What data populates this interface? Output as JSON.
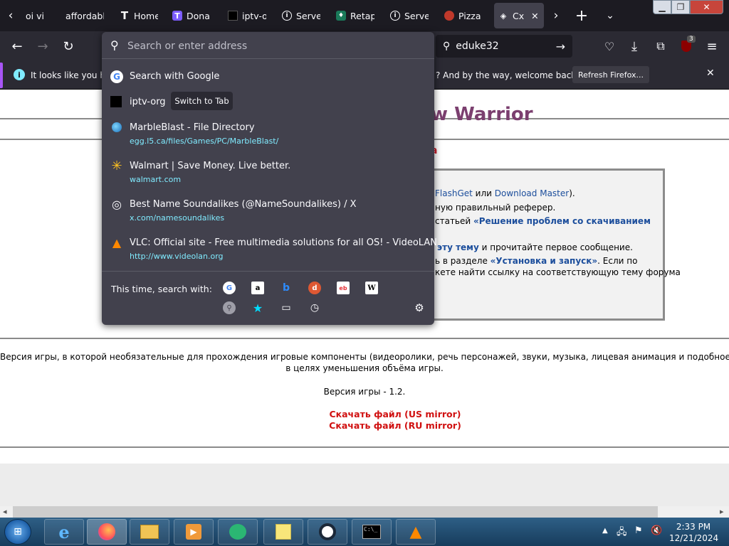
{
  "tabs": [
    {
      "label": "oi vi",
      "icon": "tab-icon"
    },
    {
      "label": "affordable",
      "icon": "tab-icon"
    },
    {
      "label": "Home",
      "icon": "t-logo-icon"
    },
    {
      "label": "Donal",
      "icon": "t-badge-icon"
    },
    {
      "label": "iptv-o",
      "icon": "square-icon"
    },
    {
      "label": "Server",
      "icon": "info-circle-icon"
    },
    {
      "label": "Retap",
      "icon": "retap-icon"
    },
    {
      "label": "Server",
      "icon": "info-circle-icon"
    },
    {
      "label": "Pizza",
      "icon": "pizza-icon"
    },
    {
      "label": "Cx",
      "icon": "diamond-icon"
    }
  ],
  "nav": {
    "search_value": "eduke32",
    "extension_badge": "3"
  },
  "notification": {
    "text_start": "It looks like you ha",
    "text_end": "? And by the way, welcome back!",
    "button": "Refresh Firefox..."
  },
  "urlbar": {
    "placeholder": "Search or enter address",
    "switch_to_tab": "Switch to Tab",
    "results": [
      {
        "title": "Search with Google",
        "url": ""
      },
      {
        "title": "iptv-org",
        "url": ""
      },
      {
        "title": "MarbleBlast - File Directory",
        "url": "egg.l5.ca/files/Games/PC/MarbleBlast/"
      },
      {
        "title": "Walmart | Save Money. Live better.",
        "url": "walmart.com"
      },
      {
        "title": "Best Name Soundalikes (@NameSoundalikes) / X",
        "url": "x.com/namesoundalikes"
      },
      {
        "title": "VLC: Official site - Free multimedia solutions for all OS! - VideoLAN",
        "url": "http://www.videolan.org"
      }
    ],
    "search_with_label": "This time, search with:",
    "engines": [
      "google",
      "amazon",
      "bing",
      "duckduckgo",
      "ebay",
      "wikipedia"
    ],
    "modes": [
      "search-icon",
      "bookmarks-icon",
      "tabs-icon",
      "history-icon"
    ]
  },
  "page": {
    "title": "w Warrior",
    "subtitle": "a",
    "info_lines": [
      {
        "a": "FlashGet",
        "b": " или ",
        "c": "Download Master",
        "d": ")."
      },
      {
        "t": "ную правильный реферер."
      },
      {
        "t": "статьей ",
        "bold": "«Решение проблем со скачиванием"
      },
      {
        "bold2": "эту тему",
        "t2": " и прочитайте первое сообщение."
      },
      {
        "t3": "ь в разделе ",
        "bold3": "«Установка и запуск»",
        "t4": ". Если по"
      },
      {
        "t5": "кете найти ссылку на соответствующую тему форума"
      }
    ],
    "description": "Версия игры, в которой необязательные для прохождения игровые компоненты (видеоролики, речь персонажей, звуки, музыка, лицевая анимация и подобное) могли быт",
    "description2": "в целях уменьшения объёма игры.",
    "version": "Версия игры - 1.2.",
    "download_us": "Скачать файл (US mirror)",
    "download_ru": "Скачать файл (RU mirror)"
  },
  "taskbar": {
    "time": "2:33 PM",
    "date": "12/21/2024"
  },
  "colors": {
    "accent": "#a855f7",
    "link": "#1c4e9c",
    "download": "#d01010",
    "title": "#7b3f6f"
  }
}
